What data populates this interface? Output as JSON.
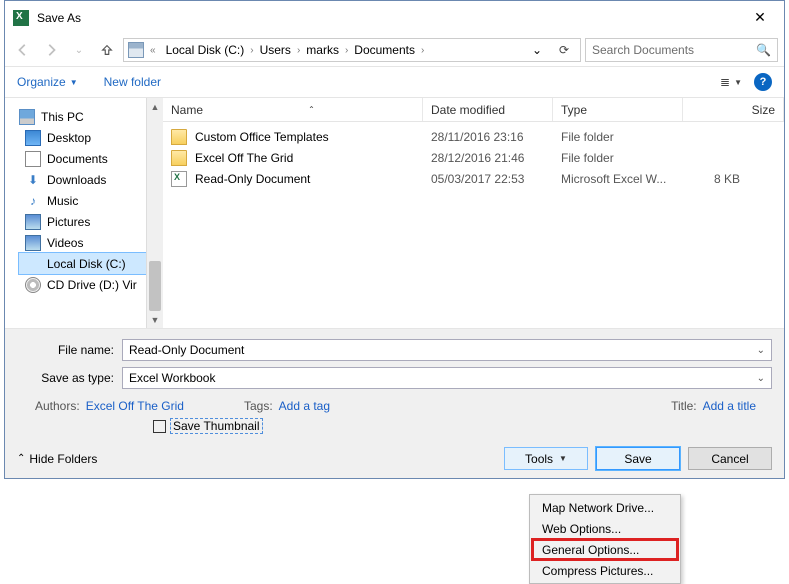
{
  "title": "Save As",
  "nav": {
    "crumbs": [
      "Local Disk (C:)",
      "Users",
      "marks",
      "Documents"
    ],
    "search_placeholder": "Search Documents"
  },
  "toolbar": {
    "organize": "Organize",
    "newfolder": "New folder"
  },
  "sidebar": {
    "root": "This PC",
    "items": [
      "Desktop",
      "Documents",
      "Downloads",
      "Music",
      "Pictures",
      "Videos",
      "Local Disk (C:)",
      "CD Drive (D:) Vir"
    ]
  },
  "columns": {
    "name": "Name",
    "date": "Date modified",
    "type": "Type",
    "size": "Size"
  },
  "files": [
    {
      "name": "Custom Office Templates",
      "date": "28/11/2016 23:16",
      "type": "File folder",
      "size": "",
      "icon": "folder"
    },
    {
      "name": "Excel Off The Grid",
      "date": "28/12/2016 21:46",
      "type": "File folder",
      "size": "",
      "icon": "folder"
    },
    {
      "name": "Read-Only Document",
      "date": "05/03/2017 22:53",
      "type": "Microsoft Excel W...",
      "size": "8 KB",
      "icon": "excel"
    }
  ],
  "form": {
    "filename_label": "File name:",
    "filename": "Read-Only Document",
    "type_label": "Save as type:",
    "type": "Excel Workbook",
    "authors_label": "Authors:",
    "authors": "Excel Off The Grid",
    "tags_label": "Tags:",
    "tags": "Add a tag",
    "title_label": "Title:",
    "title": "Add a title",
    "thumbnail": "Save Thumbnail"
  },
  "buttons": {
    "hide": "Hide Folders",
    "tools": "Tools",
    "save": "Save",
    "cancel": "Cancel"
  },
  "menu": {
    "items": [
      "Map Network Drive...",
      "Web Options...",
      "General Options...",
      "Compress Pictures..."
    ]
  }
}
